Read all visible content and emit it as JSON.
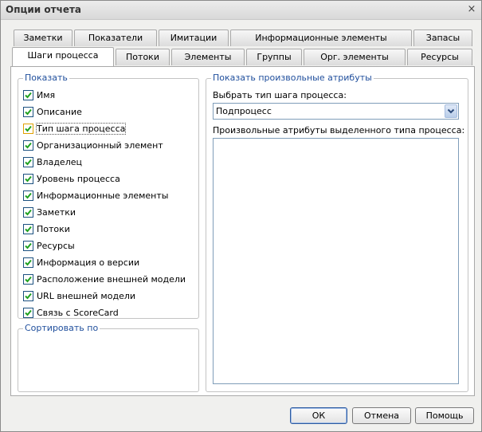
{
  "window": {
    "title": "Опции отчета",
    "close": "×"
  },
  "tabs_row1": [
    "Заметки",
    "Показатели",
    "Имитации",
    "Информационные элементы",
    "Запасы"
  ],
  "tabs_row2": [
    "Шаги процесса",
    "Потоки",
    "Элементы",
    "Группы",
    "Орг. элементы",
    "Ресурсы"
  ],
  "active_tab": "Шаги процесса",
  "show_group": {
    "title": "Показать",
    "items": [
      {
        "label": "Имя",
        "checked": true
      },
      {
        "label": "Описание",
        "checked": true
      },
      {
        "label": "Тип шага процесса",
        "checked": true
      },
      {
        "label": "Организационный элемент",
        "checked": true
      },
      {
        "label": "Владелец",
        "checked": true
      },
      {
        "label": "Уровень процесса",
        "checked": true
      },
      {
        "label": "Информационные элементы",
        "checked": true
      },
      {
        "label": "Заметки",
        "checked": true
      },
      {
        "label": "Потоки",
        "checked": true
      },
      {
        "label": "Ресурсы",
        "checked": true
      },
      {
        "label": "Информация о версии",
        "checked": true
      },
      {
        "label": "Расположение внешней модели",
        "checked": true
      },
      {
        "label": "URL внешней модели",
        "checked": true
      },
      {
        "label": "Связь с ScoreCard",
        "checked": true
      }
    ]
  },
  "sort_group": {
    "title": "Сортировать по"
  },
  "attr_group": {
    "title": "Показать произвольные атрибуты",
    "type_label": "Выбрать тип шага процесса:",
    "type_value": "Подпроцесс",
    "list_label": "Произвольные атрибуты выделенного типа процесса:"
  },
  "buttons": {
    "ok": "ОК",
    "cancel": "Отмена",
    "help": "Помощь"
  },
  "colors": {
    "legend": "#1f4e9c",
    "check": "#21a121",
    "focus_check": "#e0a000"
  }
}
